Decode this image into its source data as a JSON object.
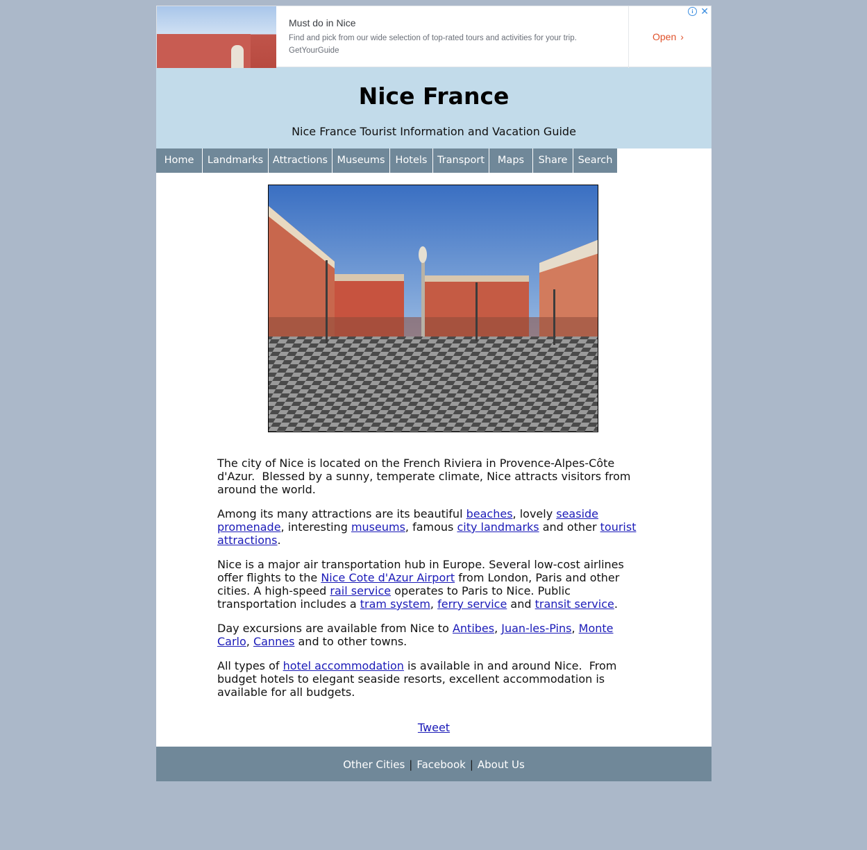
{
  "ad": {
    "title": "Must do in Nice",
    "description": "Find and pick from our wide selection of top-rated tours and activities for your trip.",
    "source": "GetYourGuide",
    "cta": "Open",
    "chevron": "›",
    "info_icon": "i",
    "close_icon": "✕"
  },
  "header": {
    "title": "Nice France",
    "tagline": "Nice France Tourist Information and Vacation Guide"
  },
  "nav": {
    "items": [
      "Home",
      "Landmarks",
      "Attractions",
      "Museums",
      "Hotels",
      "Transport",
      "Maps",
      "Share",
      "Search"
    ]
  },
  "content": {
    "p1": "The city of Nice is located on the French Riviera in Provence-Alpes-Côte d'Azur.  Blessed by a sunny, temperate climate, Nice attracts visitors from around the world.",
    "p2": {
      "t1": "Among its many attractions are its beautiful ",
      "l1": "beaches",
      "t2": ", lovely ",
      "l2": "seaside promenade",
      "t3": ", interesting ",
      "l3": "museums",
      "t4": ", famous ",
      "l4": "city landmarks",
      "t5": " and other ",
      "l5": "tourist attractions",
      "t6": "."
    },
    "p3": {
      "t1": "Nice is a major air transportation hub in Europe. Several low-cost airlines offer flights to the ",
      "l1": "Nice Cote d'Azur Airport",
      "t2": " from London, Paris and other cities. A high-speed ",
      "l2": "rail service",
      "t3": " operates to Paris to Nice. Public transportation includes a ",
      "l3": "tram system",
      "t4": ", ",
      "l4": "ferry service",
      "t5": " and ",
      "l5": "transit service",
      "t6": "."
    },
    "p4": {
      "t1": "Day excursions are available from Nice to ",
      "l1": "Antibes",
      "t2": ", ",
      "l2": "Juan-les-Pins",
      "t3": ", ",
      "l3": "Monte Carlo",
      "t4": ", ",
      "l4": "Cannes",
      "t5": " and to other towns."
    },
    "p5": {
      "t1": "All types of ",
      "l1": "hotel accommodation",
      "t2": " is available in and around Nice.  From budget hotels to elegant seaside resorts, excellent accommodation is available for all budgets."
    },
    "tweet": "Tweet"
  },
  "footer": {
    "links": [
      "Other Cities",
      "Facebook",
      "About Us"
    ],
    "separator": "|"
  },
  "colors": {
    "page_bg": "#abb8c9",
    "header_bg": "#c2dbea",
    "nav_bg": "#708899",
    "footer_bg": "#708899",
    "link": "#1a1ab8",
    "ad_cta": "#e0512a",
    "ad_icons": "#3c8ee0"
  }
}
